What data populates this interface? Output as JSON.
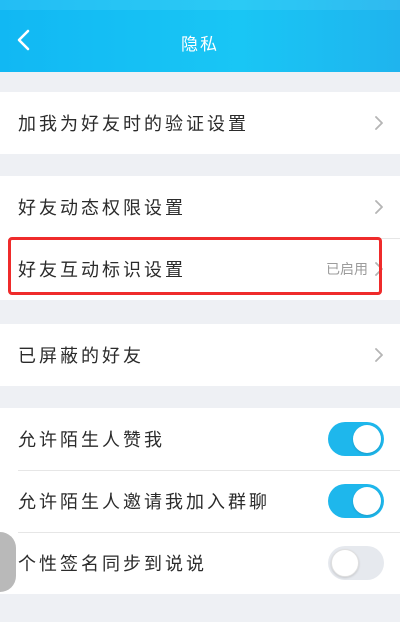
{
  "header": {
    "title": "隐私"
  },
  "groups": [
    {
      "items": [
        {
          "label": "加我为好友时的验证设置"
        }
      ]
    },
    {
      "items": [
        {
          "label": "好友动态权限设置"
        },
        {
          "label": "好友互动标识设置",
          "status": "已启用"
        }
      ]
    },
    {
      "items": [
        {
          "label": "已屏蔽的好友"
        }
      ]
    },
    {
      "items": [
        {
          "label": "允许陌生人赞我",
          "toggle": "on"
        },
        {
          "label": "允许陌生人邀请我加入群聊",
          "toggle": "on"
        },
        {
          "label": "个性签名同步到说说",
          "toggle": "off"
        }
      ]
    }
  ],
  "colors": {
    "header": "#18c0f4",
    "toggle_on": "#1eb7ec",
    "highlight": "#ef2b2b"
  }
}
